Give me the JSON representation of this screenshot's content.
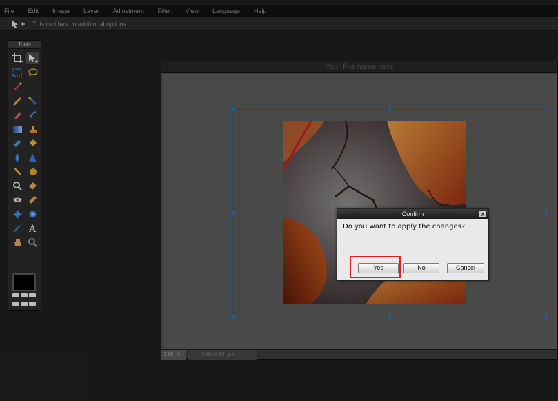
{
  "menu": {
    "items": [
      "File",
      "Edit",
      "Image",
      "Layer",
      "Adjustment",
      "Filter",
      "View",
      "Language",
      "Help"
    ]
  },
  "options_bar": {
    "icon": "move-tool-icon",
    "text": "This tool has no additional options"
  },
  "tools_panel": {
    "title": "Tools",
    "foreground_color": "#000000"
  },
  "document": {
    "title": "Your File name here",
    "zoom": "110 %",
    "dimensions": "300x300 px"
  },
  "dialog": {
    "title": "Confirm",
    "close": "x",
    "message": "Do you want to apply the changes?",
    "buttons": {
      "yes": "Yes",
      "no": "No",
      "cancel": "Cancel"
    }
  },
  "colors": {
    "highlight": "#e02020",
    "selection_handle": "#2f6fb0"
  }
}
